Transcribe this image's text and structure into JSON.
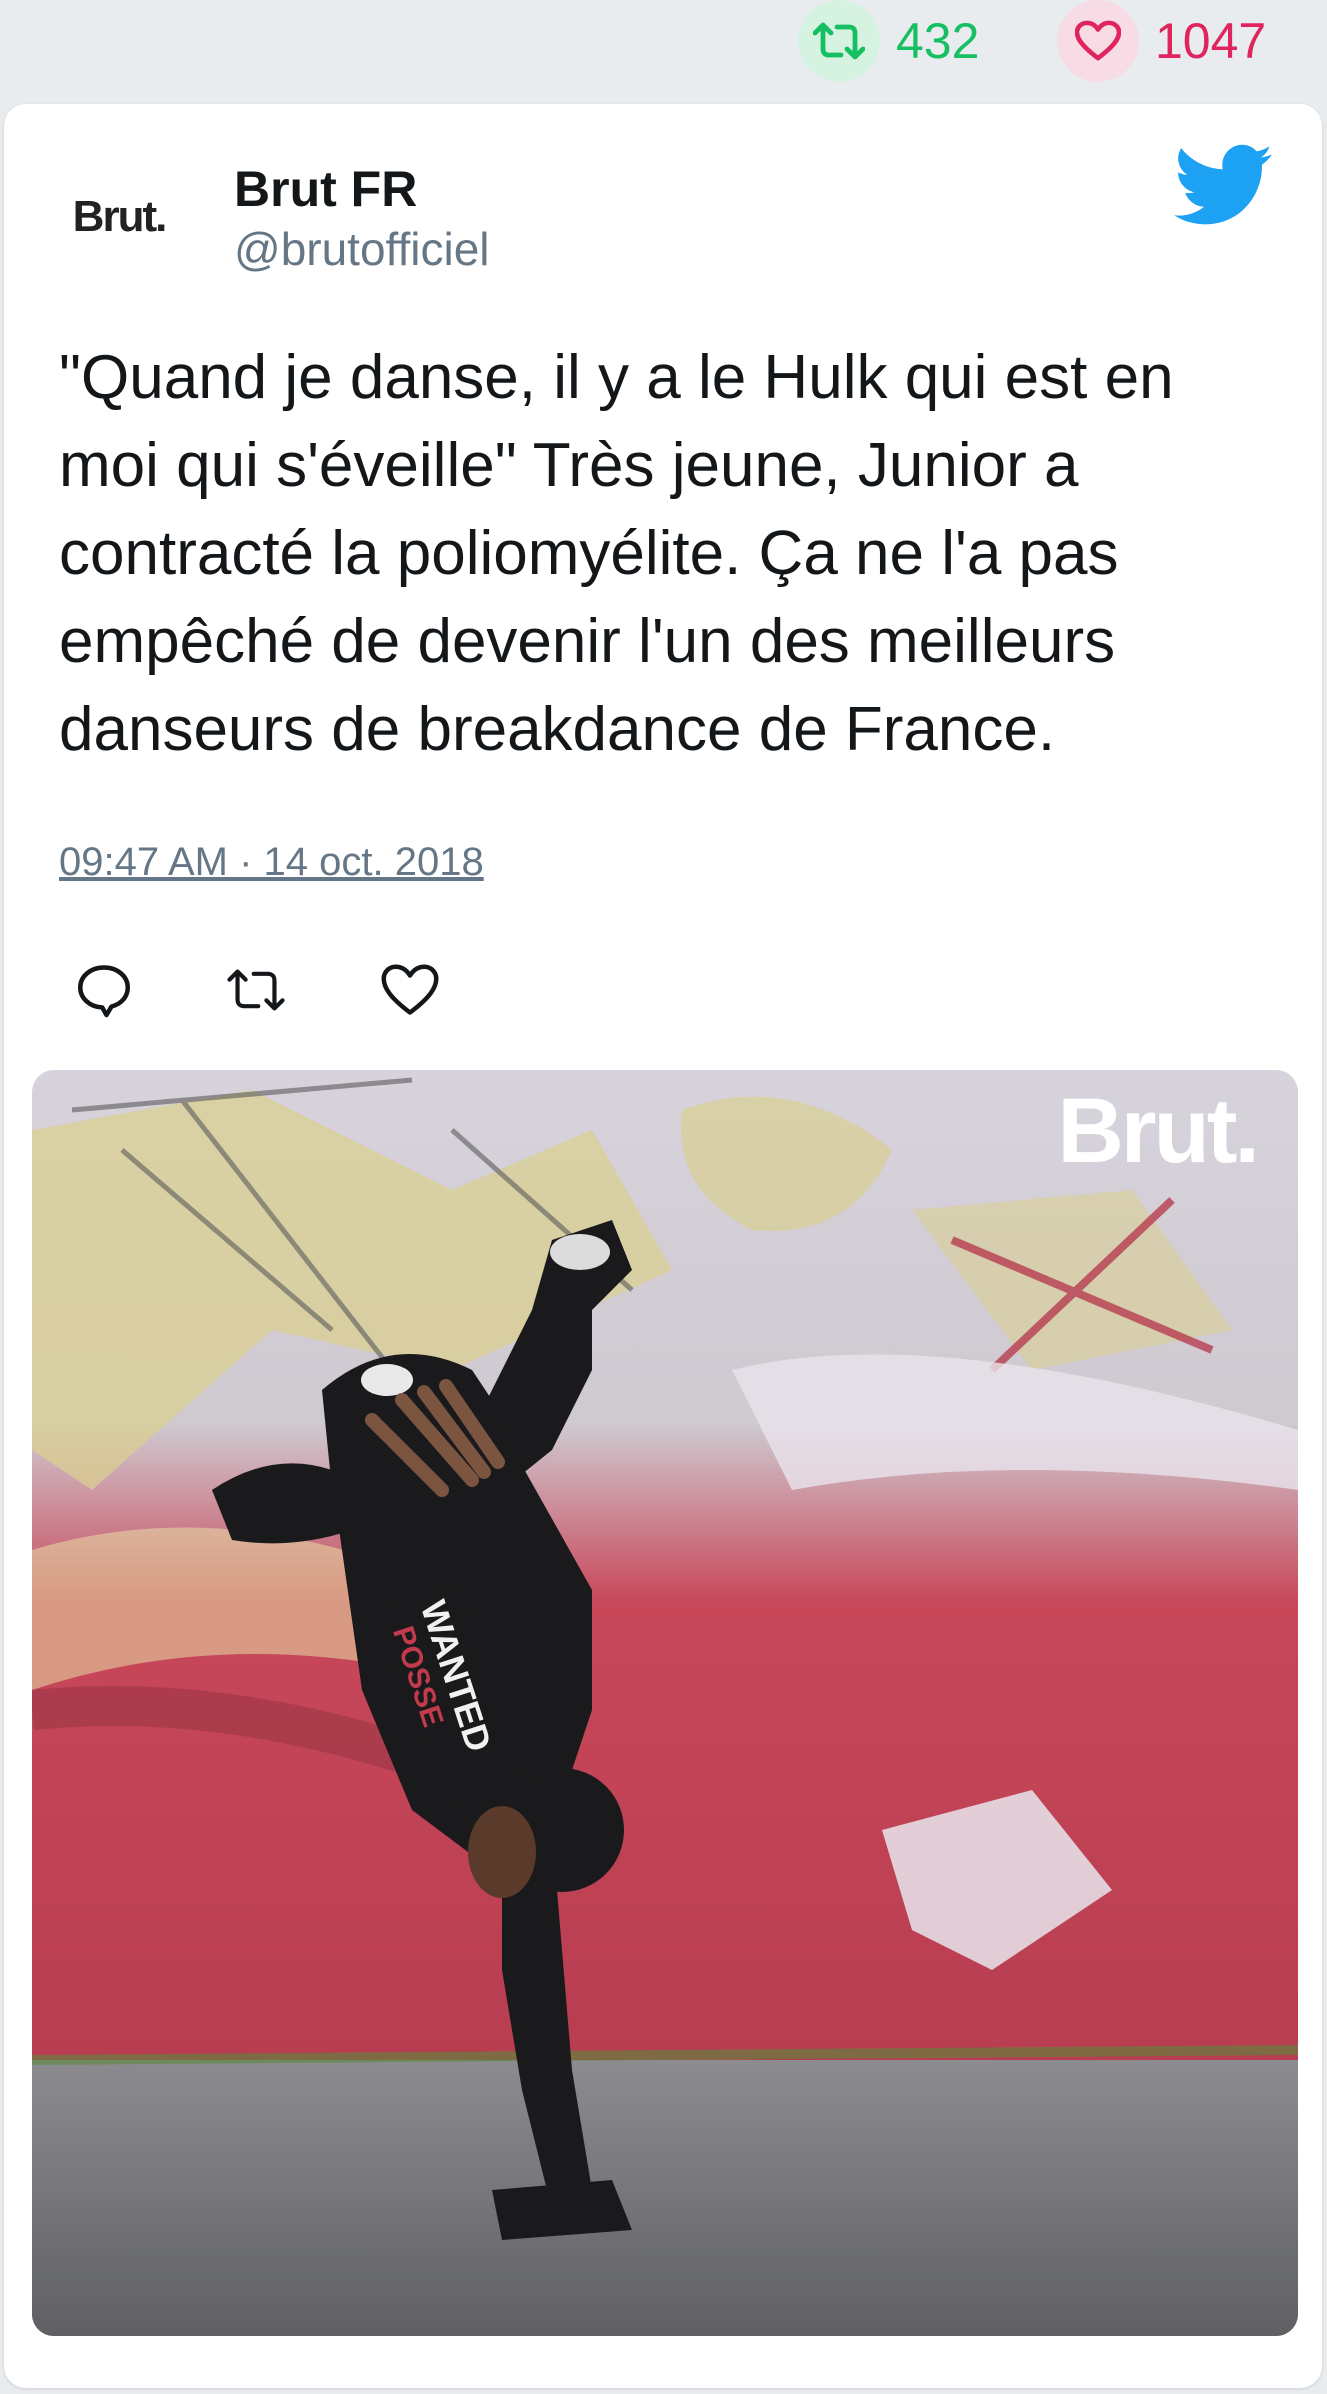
{
  "stats": {
    "retweets": "432",
    "likes": "1047"
  },
  "tweet": {
    "author_name": "Brut FR",
    "author_handle": "@brutofficiel",
    "avatar_text": "Brut.",
    "text": "\"Quand je danse, il y a le Hulk qui est en moi qui s'éveille\" Très jeune, Junior a contracté la poliomyélite. Ça ne l'a pas empêché de devenir l'un des meilleurs danseurs de breakdance de France.",
    "timestamp": "09:47 AM · 14 oct. 2018"
  },
  "media": {
    "watermark": "Brut.",
    "shirt_text": "WANTED POSSE"
  },
  "colors": {
    "twitter_blue": "#1da1f2",
    "retweet_green": "#17bf63",
    "like_red": "#e0245e"
  },
  "icons": {
    "retweet": "retweet-icon",
    "like": "heart-icon",
    "reply": "reply-icon",
    "brand": "twitter-bird-icon"
  }
}
